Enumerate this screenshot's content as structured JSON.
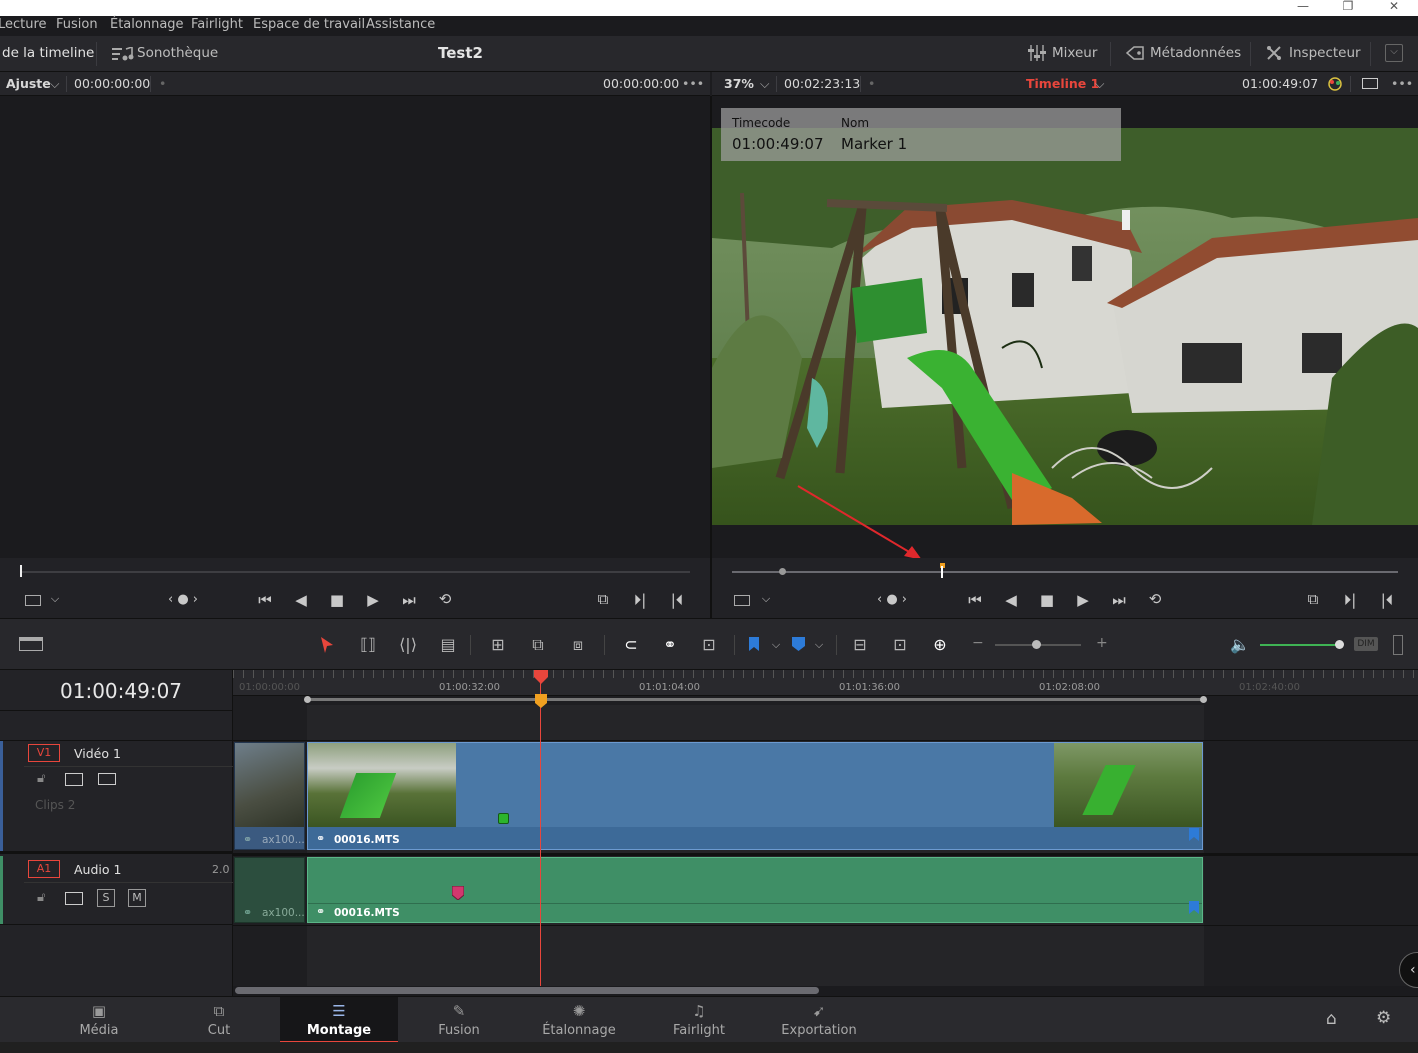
{
  "window_controls": {
    "minimize": "—",
    "maximize": "❐",
    "close": "✕"
  },
  "menu": [
    "Lecture",
    "Fusion",
    "Étalonnage",
    "Fairlight",
    "Espace de travail",
    "Assistance"
  ],
  "header": {
    "timeline_tab": "de la timeline",
    "sound_library": "Sonothèque",
    "project_title": "Test2",
    "mixer": "Mixeur",
    "metadata": "Métadonnées",
    "inspector": "Inspecteur"
  },
  "source_viewer": {
    "fit_label": "Ajuster",
    "timecode_left": "00:00:00:00",
    "timecode_right": "00:00:00:00",
    "more": "•••"
  },
  "record_viewer": {
    "zoom": "37%",
    "duration": "00:02:23:13",
    "timeline_name": "Timeline 1",
    "timecode": "01:00:49:07",
    "more": "•••"
  },
  "marker_overlay": {
    "timecode_header": "Timecode",
    "name_header": "Nom",
    "timecode_value": "01:00:49:07",
    "name_value": "Marker 1"
  },
  "timeline": {
    "current_timecode": "01:00:49:07",
    "ruler": [
      "01:00:00:00",
      "01:00:32:00",
      "01:01:04:00",
      "01:01:36:00",
      "01:02:08:00",
      "01:02:40:00"
    ],
    "dim_label": "DIM",
    "tracks": {
      "video": {
        "id": "V1",
        "name": "Vidéo 1",
        "clips_count": "Clips 2"
      },
      "audio": {
        "id": "A1",
        "name": "Audio 1",
        "channels": "2.0",
        "solo": "S",
        "mute": "M"
      }
    },
    "clips": {
      "first_video": "ax100...",
      "main_video": "00016.MTS",
      "first_audio": "ax100...",
      "main_audio": "00016.MTS"
    },
    "volume_level": 1.0
  },
  "bottom_nav": [
    {
      "label": "Média",
      "icon": "media-icon"
    },
    {
      "label": "Cut",
      "icon": "cut-icon"
    },
    {
      "label": "Montage",
      "icon": "edit-icon",
      "active": true
    },
    {
      "label": "Fusion",
      "icon": "fusion-icon"
    },
    {
      "label": "Étalonnage",
      "icon": "color-icon"
    },
    {
      "label": "Fairlight",
      "icon": "fairlight-icon"
    },
    {
      "label": "Exportation",
      "icon": "deliver-icon"
    }
  ],
  "colors": {
    "accent_red": "#e8463c",
    "video_clip": "#4a78a6",
    "audio_clip": "#3f8f66",
    "marker_orange": "#f0a020",
    "marker_green": "#2cb52c",
    "marker_pink": "#d2386e",
    "timeline_name": "#e8463c"
  }
}
